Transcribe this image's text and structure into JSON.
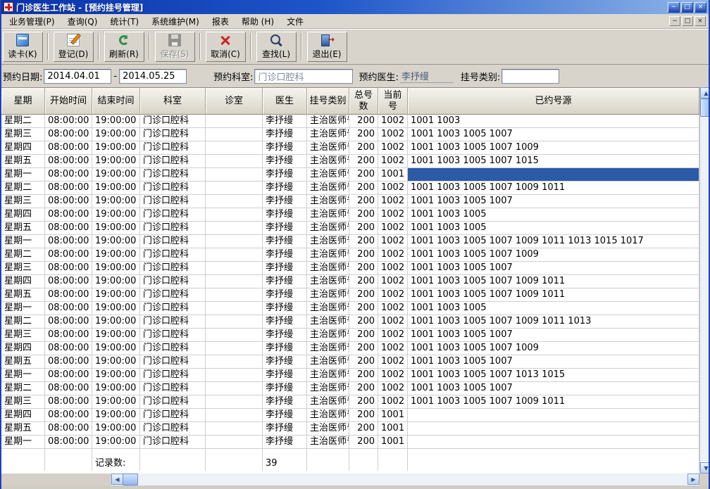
{
  "window": {
    "title": "门诊医生工作站 - [预约挂号管理]"
  },
  "menu": {
    "items": [
      "业务管理(P)",
      "查询(Q)",
      "统计(T)",
      "系统维护(M)",
      "报表",
      "帮助 (H)",
      "文件"
    ]
  },
  "toolbar": {
    "buttons": [
      {
        "name": "read-card-button",
        "label": "读卡(K)",
        "icon": "card-icon",
        "enabled": true
      },
      {
        "name": "register-button",
        "label": "登记(D)",
        "icon": "register-icon",
        "enabled": true
      },
      {
        "name": "refresh-button",
        "label": "刷新(R)",
        "icon": "refresh-icon",
        "enabled": true
      },
      {
        "name": "save-button",
        "label": "保存(S)",
        "icon": "save-icon",
        "enabled": false
      },
      {
        "name": "cancel-button",
        "label": "取消(C)",
        "icon": "cancel-icon",
        "enabled": true
      },
      {
        "name": "find-button",
        "label": "查找(L)",
        "icon": "search-icon",
        "enabled": true
      },
      {
        "name": "exit-button",
        "label": "退出(E)",
        "icon": "exit-icon",
        "enabled": true
      }
    ]
  },
  "filters": {
    "date_label": "预约日期:",
    "date_from": "2014.04.01",
    "date_separator": "-",
    "date_to": "2014.05.25",
    "department_label": "预约科室:",
    "department_value": "门诊口腔科",
    "doctor_label": "预约医生:",
    "doctor_value": "李抒缦",
    "reg_type_label": "挂号类别:",
    "reg_type_value": ""
  },
  "table": {
    "headers": [
      "星期",
      "开始时间",
      "结束时间",
      "科室",
      "诊室",
      "医生",
      "挂号类别",
      "总号数",
      "当前号",
      "已约号源"
    ],
    "rows": [
      [
        "星期二",
        "08:00:00",
        "19:00:00",
        "门诊口腔科",
        "",
        "李抒缦",
        "主治医师号",
        "200",
        "1002",
        "1001 1003"
      ],
      [
        "星期三",
        "08:00:00",
        "19:00:00",
        "门诊口腔科",
        "",
        "李抒缦",
        "主治医师号",
        "200",
        "1002",
        "1001 1003 1005 1007"
      ],
      [
        "星期四",
        "08:00:00",
        "19:00:00",
        "门诊口腔科",
        "",
        "李抒缦",
        "主治医师号",
        "200",
        "1002",
        "1001 1003 1005 1007 1009"
      ],
      [
        "星期五",
        "08:00:00",
        "19:00:00",
        "门诊口腔科",
        "",
        "李抒缦",
        "主治医师号",
        "200",
        "1002",
        "1001 1003 1005 1007 1015"
      ],
      [
        "星期一",
        "08:00:00",
        "19:00:00",
        "门诊口腔科",
        "",
        "李抒缦",
        "主治医师号",
        "200",
        "1001",
        ""
      ],
      [
        "星期二",
        "08:00:00",
        "19:00:00",
        "门诊口腔科",
        "",
        "李抒缦",
        "主治医师号",
        "200",
        "1002",
        "1001 1003 1005 1007 1009 1011"
      ],
      [
        "星期三",
        "08:00:00",
        "19:00:00",
        "门诊口腔科",
        "",
        "李抒缦",
        "主治医师号",
        "200",
        "1002",
        "1001 1003 1005 1007"
      ],
      [
        "星期四",
        "08:00:00",
        "19:00:00",
        "门诊口腔科",
        "",
        "李抒缦",
        "主治医师号",
        "200",
        "1002",
        "1001 1003 1005"
      ],
      [
        "星期五",
        "08:00:00",
        "19:00:00",
        "门诊口腔科",
        "",
        "李抒缦",
        "主治医师号",
        "200",
        "1002",
        "1001 1003 1005"
      ],
      [
        "星期一",
        "08:00:00",
        "19:00:00",
        "门诊口腔科",
        "",
        "李抒缦",
        "主治医师号",
        "200",
        "1002",
        "1001 1003 1005 1007 1009 1011 1013 1015 1017"
      ],
      [
        "星期二",
        "08:00:00",
        "19:00:00",
        "门诊口腔科",
        "",
        "李抒缦",
        "主治医师号",
        "200",
        "1002",
        "1001 1003 1005 1007 1009"
      ],
      [
        "星期三",
        "08:00:00",
        "19:00:00",
        "门诊口腔科",
        "",
        "李抒缦",
        "主治医师号",
        "200",
        "1002",
        "1001 1003 1005 1007"
      ],
      [
        "星期四",
        "08:00:00",
        "19:00:00",
        "门诊口腔科",
        "",
        "李抒缦",
        "主治医师号",
        "200",
        "1002",
        "1001 1003 1005 1007 1009 1011"
      ],
      [
        "星期五",
        "08:00:00",
        "19:00:00",
        "门诊口腔科",
        "",
        "李抒缦",
        "主治医师号",
        "200",
        "1002",
        "1001 1003 1005 1007 1009 1011"
      ],
      [
        "星期一",
        "08:00:00",
        "19:00:00",
        "门诊口腔科",
        "",
        "李抒缦",
        "主治医师号",
        "200",
        "1002",
        "1001 1003 1005"
      ],
      [
        "星期二",
        "08:00:00",
        "19:00:00",
        "门诊口腔科",
        "",
        "李抒缦",
        "主治医师号",
        "200",
        "1002",
        "1001 1003 1005 1007 1009 1011 1013"
      ],
      [
        "星期三",
        "08:00:00",
        "19:00:00",
        "门诊口腔科",
        "",
        "李抒缦",
        "主治医师号",
        "200",
        "1002",
        "1001 1003 1005 1007"
      ],
      [
        "星期四",
        "08:00:00",
        "19:00:00",
        "门诊口腔科",
        "",
        "李抒缦",
        "主治医师号",
        "200",
        "1002",
        "1001 1003 1005 1007 1009"
      ],
      [
        "星期五",
        "08:00:00",
        "19:00:00",
        "门诊口腔科",
        "",
        "李抒缦",
        "主治医师号",
        "200",
        "1002",
        "1001 1003 1005 1007"
      ],
      [
        "星期一",
        "08:00:00",
        "19:00:00",
        "门诊口腔科",
        "",
        "李抒缦",
        "主治医师号",
        "200",
        "1002",
        "1001 1003 1005 1007 1013 1015"
      ],
      [
        "星期二",
        "08:00:00",
        "19:00:00",
        "门诊口腔科",
        "",
        "李抒缦",
        "主治医师号",
        "200",
        "1002",
        "1001 1003 1005 1007"
      ],
      [
        "星期三",
        "08:00:00",
        "19:00:00",
        "门诊口腔科",
        "",
        "李抒缦",
        "主治医师号",
        "200",
        "1002",
        "1001 1003 1005 1007 1009 1011"
      ],
      [
        "星期四",
        "08:00:00",
        "19:00:00",
        "门诊口腔科",
        "",
        "李抒缦",
        "主治医师号",
        "200",
        "1001",
        ""
      ],
      [
        "星期五",
        "08:00:00",
        "19:00:00",
        "门诊口腔科",
        "",
        "李抒缦",
        "主治医师号",
        "200",
        "1001",
        ""
      ],
      [
        "星期一",
        "08:00:00",
        "19:00:00",
        "门诊口腔科",
        "",
        "李抒缦",
        "主治医师号",
        "200",
        "1001",
        ""
      ]
    ],
    "selected": {
      "row": 4,
      "col": 9
    },
    "footer": {
      "label": "记录数:",
      "value": "39"
    }
  },
  "window_controls": {
    "minimize": "−",
    "restore": "□",
    "close": "×"
  },
  "colors": {
    "selection": "#2b5aa6",
    "titlebar_start": "#0a33a8",
    "titlebar_end": "#8fb5e8",
    "header_bg": "#e3dfd4",
    "grid_line": "#cfcfcf"
  }
}
